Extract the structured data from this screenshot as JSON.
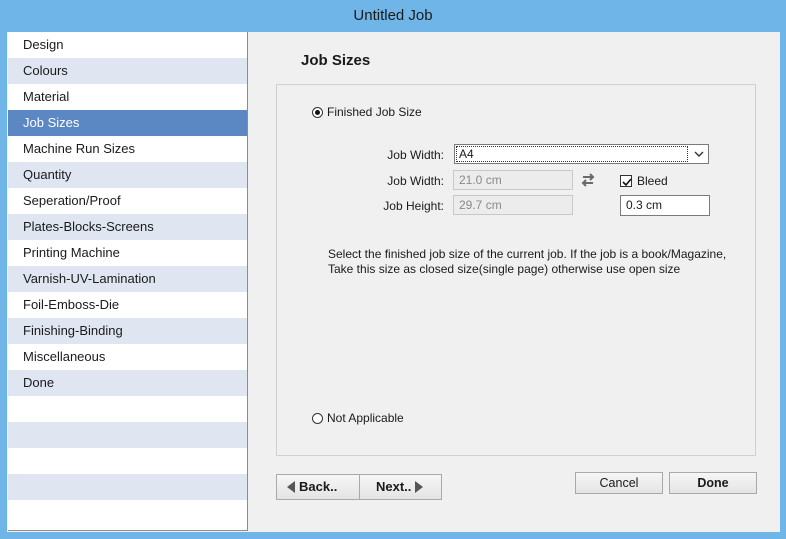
{
  "window": {
    "title": "Untitled Job"
  },
  "sidebar": {
    "items": [
      {
        "label": "Design"
      },
      {
        "label": "Colours"
      },
      {
        "label": "Material"
      },
      {
        "label": "Job Sizes"
      },
      {
        "label": "Machine Run Sizes"
      },
      {
        "label": "Quantity"
      },
      {
        "label": "Seperation/Proof"
      },
      {
        "label": "Plates-Blocks-Screens"
      },
      {
        "label": "Printing Machine"
      },
      {
        "label": "Varnish-UV-Lamination"
      },
      {
        "label": "Foil-Emboss-Die"
      },
      {
        "label": "Finishing-Binding"
      },
      {
        "label": "Miscellaneous"
      },
      {
        "label": "Done"
      }
    ],
    "selected": "Job Sizes"
  },
  "main": {
    "heading": "Job Sizes",
    "finished_radio_label": "Finished Job Size",
    "size_select_label": "Job Width:",
    "size_select_value": "A4",
    "width_label": "Job Width:",
    "width_value": "21.0 cm",
    "height_label": "Job Height:",
    "height_value": "29.7 cm",
    "bleed_label": "Bleed",
    "bleed_checked": true,
    "bleed_value": "0.3 cm",
    "info_line1": "Select the finished job size of the current job. If the job is a book/Magazine,",
    "info_line2": "Take this size as closed size(single page) otherwise use open size",
    "not_applicable_label": "Not Applicable"
  },
  "footer": {
    "back_label": "Back..",
    "next_label": "Next..",
    "cancel_label": "Cancel",
    "done_label": "Done"
  },
  "icons": {
    "swap": "swap-arrows-icon",
    "checkmark": "checkmark-icon",
    "dropdown": "chevron-down-icon"
  }
}
